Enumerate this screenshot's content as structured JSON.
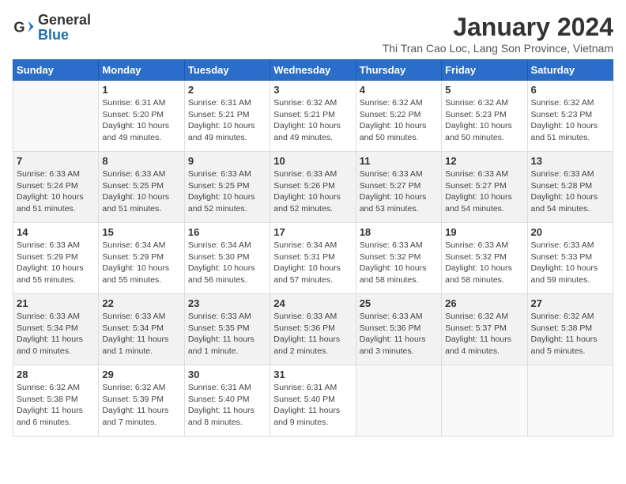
{
  "header": {
    "logo_general": "General",
    "logo_blue": "Blue",
    "month_title": "January 2024",
    "location": "Thi Tran Cao Loc, Lang Son Province, Vietnam"
  },
  "days_of_week": [
    "Sunday",
    "Monday",
    "Tuesday",
    "Wednesday",
    "Thursday",
    "Friday",
    "Saturday"
  ],
  "weeks": [
    [
      {
        "day": "",
        "info": ""
      },
      {
        "day": "1",
        "info": "Sunrise: 6:31 AM\nSunset: 5:20 PM\nDaylight: 10 hours\nand 49 minutes."
      },
      {
        "day": "2",
        "info": "Sunrise: 6:31 AM\nSunset: 5:21 PM\nDaylight: 10 hours\nand 49 minutes."
      },
      {
        "day": "3",
        "info": "Sunrise: 6:32 AM\nSunset: 5:21 PM\nDaylight: 10 hours\nand 49 minutes."
      },
      {
        "day": "4",
        "info": "Sunrise: 6:32 AM\nSunset: 5:22 PM\nDaylight: 10 hours\nand 50 minutes."
      },
      {
        "day": "5",
        "info": "Sunrise: 6:32 AM\nSunset: 5:23 PM\nDaylight: 10 hours\nand 50 minutes."
      },
      {
        "day": "6",
        "info": "Sunrise: 6:32 AM\nSunset: 5:23 PM\nDaylight: 10 hours\nand 51 minutes."
      }
    ],
    [
      {
        "day": "7",
        "info": "Sunrise: 6:33 AM\nSunset: 5:24 PM\nDaylight: 10 hours\nand 51 minutes."
      },
      {
        "day": "8",
        "info": "Sunrise: 6:33 AM\nSunset: 5:25 PM\nDaylight: 10 hours\nand 51 minutes."
      },
      {
        "day": "9",
        "info": "Sunrise: 6:33 AM\nSunset: 5:25 PM\nDaylight: 10 hours\nand 52 minutes."
      },
      {
        "day": "10",
        "info": "Sunrise: 6:33 AM\nSunset: 5:26 PM\nDaylight: 10 hours\nand 52 minutes."
      },
      {
        "day": "11",
        "info": "Sunrise: 6:33 AM\nSunset: 5:27 PM\nDaylight: 10 hours\nand 53 minutes."
      },
      {
        "day": "12",
        "info": "Sunrise: 6:33 AM\nSunset: 5:27 PM\nDaylight: 10 hours\nand 54 minutes."
      },
      {
        "day": "13",
        "info": "Sunrise: 6:33 AM\nSunset: 5:28 PM\nDaylight: 10 hours\nand 54 minutes."
      }
    ],
    [
      {
        "day": "14",
        "info": "Sunrise: 6:33 AM\nSunset: 5:29 PM\nDaylight: 10 hours\nand 55 minutes."
      },
      {
        "day": "15",
        "info": "Sunrise: 6:34 AM\nSunset: 5:29 PM\nDaylight: 10 hours\nand 55 minutes."
      },
      {
        "day": "16",
        "info": "Sunrise: 6:34 AM\nSunset: 5:30 PM\nDaylight: 10 hours\nand 56 minutes."
      },
      {
        "day": "17",
        "info": "Sunrise: 6:34 AM\nSunset: 5:31 PM\nDaylight: 10 hours\nand 57 minutes."
      },
      {
        "day": "18",
        "info": "Sunrise: 6:33 AM\nSunset: 5:32 PM\nDaylight: 10 hours\nand 58 minutes."
      },
      {
        "day": "19",
        "info": "Sunrise: 6:33 AM\nSunset: 5:32 PM\nDaylight: 10 hours\nand 58 minutes."
      },
      {
        "day": "20",
        "info": "Sunrise: 6:33 AM\nSunset: 5:33 PM\nDaylight: 10 hours\nand 59 minutes."
      }
    ],
    [
      {
        "day": "21",
        "info": "Sunrise: 6:33 AM\nSunset: 5:34 PM\nDaylight: 11 hours\nand 0 minutes."
      },
      {
        "day": "22",
        "info": "Sunrise: 6:33 AM\nSunset: 5:34 PM\nDaylight: 11 hours\nand 1 minute."
      },
      {
        "day": "23",
        "info": "Sunrise: 6:33 AM\nSunset: 5:35 PM\nDaylight: 11 hours\nand 1 minute."
      },
      {
        "day": "24",
        "info": "Sunrise: 6:33 AM\nSunset: 5:36 PM\nDaylight: 11 hours\nand 2 minutes."
      },
      {
        "day": "25",
        "info": "Sunrise: 6:33 AM\nSunset: 5:36 PM\nDaylight: 11 hours\nand 3 minutes."
      },
      {
        "day": "26",
        "info": "Sunrise: 6:32 AM\nSunset: 5:37 PM\nDaylight: 11 hours\nand 4 minutes."
      },
      {
        "day": "27",
        "info": "Sunrise: 6:32 AM\nSunset: 5:38 PM\nDaylight: 11 hours\nand 5 minutes."
      }
    ],
    [
      {
        "day": "28",
        "info": "Sunrise: 6:32 AM\nSunset: 5:38 PM\nDaylight: 11 hours\nand 6 minutes."
      },
      {
        "day": "29",
        "info": "Sunrise: 6:32 AM\nSunset: 5:39 PM\nDaylight: 11 hours\nand 7 minutes."
      },
      {
        "day": "30",
        "info": "Sunrise: 6:31 AM\nSunset: 5:40 PM\nDaylight: 11 hours\nand 8 minutes."
      },
      {
        "day": "31",
        "info": "Sunrise: 6:31 AM\nSunset: 5:40 PM\nDaylight: 11 hours\nand 9 minutes."
      },
      {
        "day": "",
        "info": ""
      },
      {
        "day": "",
        "info": ""
      },
      {
        "day": "",
        "info": ""
      }
    ]
  ]
}
